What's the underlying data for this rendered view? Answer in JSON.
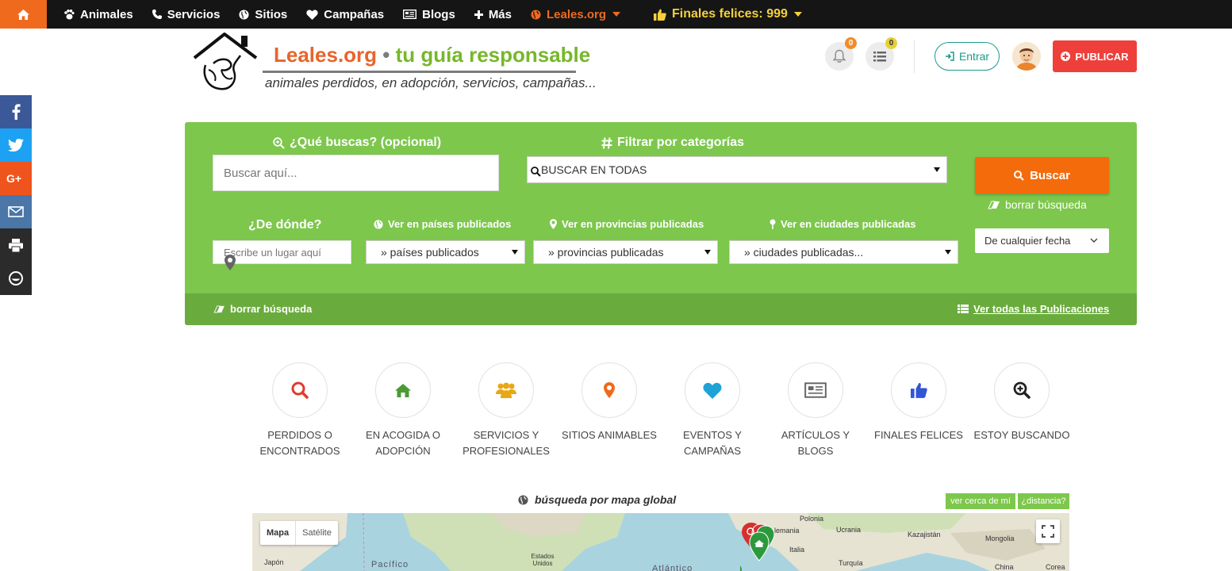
{
  "nav": {
    "home_icon": "home-icon",
    "items": [
      {
        "label": "Animales",
        "icon": "paw-icon"
      },
      {
        "label": "Servicios",
        "icon": "phone-icon"
      },
      {
        "label": "Sitios",
        "icon": "globe-icon"
      },
      {
        "label": "Campañas",
        "icon": "heart-icon"
      },
      {
        "label": "Blogs",
        "icon": "newspaper-icon"
      },
      {
        "label": "Más",
        "icon": "plus-icon"
      }
    ],
    "site_menu": "Leales.org",
    "finales": "Finales felices: 999"
  },
  "header": {
    "brand_part1": "Leales.org",
    "brand_sep": "•",
    "brand_part2": "tu guía responsable",
    "tagline": "animales perdidos, en adopción, servicios, campañas...",
    "notifications_count": "0",
    "list_count": "0",
    "login_label": "Entrar",
    "publish_label": "PUBLICAR"
  },
  "share": [
    {
      "icon": "facebook-icon",
      "color": "#3b5998"
    },
    {
      "icon": "twitter-icon",
      "color": "#1da1f2"
    },
    {
      "icon": "google-plus-icon",
      "color": "#f0541d"
    },
    {
      "icon": "email-icon",
      "color": "#4a76a8"
    },
    {
      "icon": "print-icon",
      "color": "#2b2b2b"
    },
    {
      "icon": "more-share-icon",
      "color": "#2b2b2b"
    }
  ],
  "search": {
    "query_label": "¿Qué buscas? (opcional)",
    "query_placeholder": "Buscar aquí...",
    "category_label": "Filtrar por categorías",
    "category_value": "BUSCAR EN TODAS",
    "search_button": "Buscar",
    "clear_label": "borrar búsqueda",
    "where_label": "¿De dónde?",
    "where_placeholder": "Escribe un lugar aquí",
    "countries_label": "Ver en países publicados",
    "countries_value": "» países publicados",
    "provinces_label": "Ver en provincias publicadas",
    "provinces_value": "» provincias publicadas",
    "cities_label": "Ver en ciudades publicadas",
    "cities_value": "» ciudades publicadas...",
    "date_value": "De cualquier fecha",
    "footer_clear": "borrar búsqueda",
    "footer_all": "Ver todas las Publicaciones"
  },
  "categories": [
    {
      "line1": "PERDIDOS O",
      "line2": "ENCONTRADOS",
      "icon": "search-icon",
      "color": "#e03b2e"
    },
    {
      "line1": "EN ACOGIDA O",
      "line2": "ADOPCIÓN",
      "icon": "home-icon",
      "color": "#4c9a35"
    },
    {
      "line1": "SERVICIOS Y",
      "line2": "PROFESIONALES",
      "icon": "users-icon",
      "color": "#e8a715"
    },
    {
      "line1": "SITIOS ANIMABLES",
      "line2": "",
      "icon": "map-marker-icon",
      "color": "#ee6a1c"
    },
    {
      "line1": "EVENTOS Y",
      "line2": "CAMPAÑAS",
      "icon": "heart-icon",
      "color": "#1fa3d6"
    },
    {
      "line1": "ARTÍCULOS Y",
      "line2": "BLOGS",
      "icon": "newspaper-icon",
      "color": "#666666"
    },
    {
      "line1": "FINALES FELICES",
      "line2": "",
      "icon": "thumbs-up-icon",
      "color": "#3155d6"
    },
    {
      "line1": "ESTOY BUSCANDO",
      "line2": "",
      "icon": "zoom-in-icon",
      "color": "#222222"
    }
  ],
  "map": {
    "title": "búsqueda por mapa global",
    "near_me": "ver cerca de mí",
    "distance": "¿distancia?",
    "type_map": "Mapa",
    "type_satellite": "Satélite",
    "labels": [
      "Polonia",
      "Alemania",
      "Ucrania",
      "Kazajistán",
      "Italia",
      "Mongolia",
      "Turquía",
      "China",
      "Corea",
      "Japón",
      "Pacífico",
      "Estados Unidos",
      "Atlántico"
    ]
  }
}
